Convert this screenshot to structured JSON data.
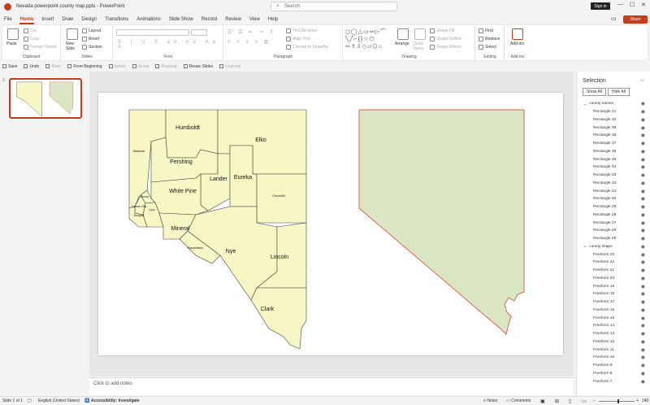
{
  "window": {
    "title": "Nevada powerpoint county map.pptx  -  PowerPoint",
    "search_placeholder": "Search",
    "signin_label": "Sign in",
    "share_label": "Share"
  },
  "menu": {
    "tabs": [
      "File",
      "Home",
      "Insert",
      "Draw",
      "Design",
      "Transitions",
      "Animations",
      "Slide Show",
      "Record",
      "Review",
      "View",
      "Help"
    ],
    "active": "Home"
  },
  "ribbon": {
    "clipboard": {
      "paste": "Paste",
      "cut": "Cut",
      "copy": "Copy",
      "format_painter": "Format Painter",
      "label": "Clipboard"
    },
    "slides": {
      "new_slide": "New Slide",
      "layout": "Layout",
      "reset": "Reset",
      "section": "Section",
      "label": "Slides"
    },
    "font": {
      "label": "Font"
    },
    "paragraph": {
      "text_direction": "Text Direction",
      "align_text": "Align Text",
      "smartart": "Convert to SmartArt",
      "label": "Paragraph"
    },
    "drawing": {
      "arrange": "Arrange",
      "quick_styles": "Quick Styles",
      "shape_fill": "Shape Fill",
      "shape_outline": "Shape Outline",
      "shape_effects": "Shape Effects",
      "label": "Drawing"
    },
    "editing": {
      "find": "Find",
      "replace": "Replace",
      "select": "Select",
      "label": "Editing"
    },
    "addins": {
      "addins": "Add-ins",
      "label": "Add-ins"
    }
  },
  "qat": {
    "items": [
      {
        "label": "Save",
        "enabled": true
      },
      {
        "label": "Undo",
        "enabled": true
      },
      {
        "label": "Redo",
        "enabled": false
      },
      {
        "label": "From Beginning",
        "enabled": true
      },
      {
        "label": "Indent",
        "enabled": false
      },
      {
        "label": "Group",
        "enabled": false
      },
      {
        "label": "Regroup",
        "enabled": false
      },
      {
        "label": "Reuse Slides",
        "enabled": true
      },
      {
        "label": "Ungroup",
        "enabled": false
      }
    ]
  },
  "thumbnails": {
    "slide_number": "1"
  },
  "slide": {
    "counties": [
      "Humboldt",
      "Elko",
      "Washoe",
      "Pershing",
      "Lander",
      "Eureka",
      "Churchill",
      "White Pine",
      "Storey",
      "Carson City",
      "Lyon",
      "Douglas",
      "Mineral",
      "Esmeralda",
      "Nye",
      "Lincoln",
      "Clark"
    ],
    "colors": {
      "county_fill": "#f7f7c5",
      "shape_fill": "#d9e5c3",
      "shape_outline": "#e0615a"
    }
  },
  "notes": {
    "placeholder": "Click to add notes"
  },
  "selection_pane": {
    "title": "Selection",
    "show_all": "Show All",
    "hide_all": "Hide All",
    "groups": [
      {
        "name": "county names",
        "items": [
          "Rectangle 41",
          "Rectangle 40",
          "Rectangle 39",
          "Rectangle 38",
          "Rectangle 37",
          "Rectangle 36",
          "Rectangle 35",
          "Rectangle 34",
          "Rectangle 33",
          "Rectangle 32",
          "Rectangle 31",
          "Rectangle 30",
          "Rectangle 29",
          "Rectangle 28",
          "Rectangle 27",
          "Rectangle 26",
          "Rectangle 25"
        ]
      },
      {
        "name": "county shape",
        "items": [
          "Freeform 23",
          "Freeform 22",
          "Freeform 21",
          "Freeform 20",
          "Freeform 19",
          "Freeform 18",
          "Freeform 17",
          "Freeform 16",
          "Freeform 15",
          "Freeform 14",
          "Freeform 13",
          "Freeform 12",
          "Freeform 11",
          "Freeform 10",
          "Freeform 9",
          "Freeform 8",
          "Freeform 7"
        ]
      }
    ]
  },
  "status": {
    "slide": "Slide 1 of 1",
    "language": "English (United States)",
    "accessibility": "Accessibility: Investigate",
    "notes": "Notes",
    "comments": "Comments",
    "zoom": "140"
  }
}
